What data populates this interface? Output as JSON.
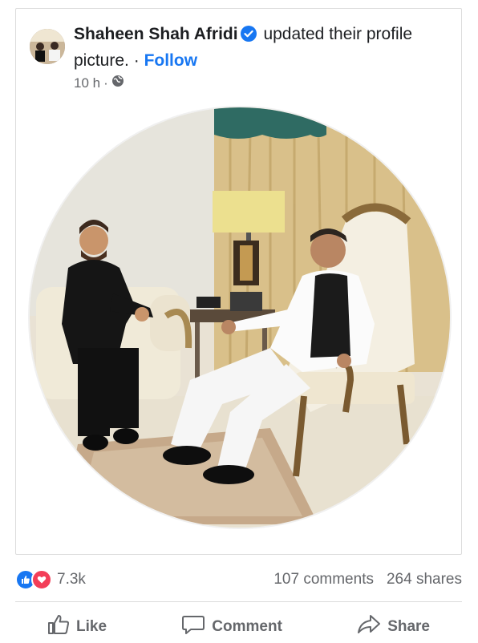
{
  "post": {
    "author": "Shaheen Shah Afridi",
    "action_text": "updated their profile picture.",
    "separator": "·",
    "follow_label": "Follow",
    "time": "10 h",
    "meta_separator": "·",
    "audience_icon": "globe-icon"
  },
  "stats": {
    "reactions_count": "7.3k",
    "reaction_icons": [
      "like-icon",
      "love-icon"
    ],
    "comments": "107 comments",
    "shares": "264 shares"
  },
  "actions": {
    "like_label": "Like",
    "comment_label": "Comment",
    "share_label": "Share"
  },
  "colors": {
    "accent": "#1877f2",
    "love": "#f33e58",
    "muted": "#65676b"
  }
}
